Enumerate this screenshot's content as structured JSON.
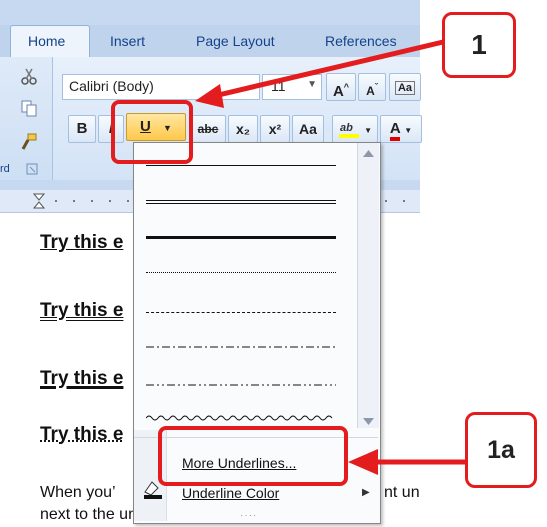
{
  "ribbon": {
    "tabs": [
      "Home",
      "Insert",
      "Page Layout",
      "References"
    ],
    "font_name": "Calibri (Body)",
    "font_size": "11",
    "group_label": "rd",
    "buttons": {
      "bold": "B",
      "italic": "I",
      "underline": "U",
      "strikethrough": "abc",
      "subscript": "x₂",
      "superscript": "x²",
      "change_case": "Aa",
      "grow_font": "A",
      "shrink_font": "A",
      "font_color": "A"
    }
  },
  "document": {
    "lines": [
      "Try this e",
      "Try this e",
      "Try this e",
      "Try this e"
    ],
    "paragraph_1": "When you’",
    "paragraph_1_tail": "nt un",
    "paragraph_2": "next to the underline button Or click on the l"
  },
  "menu": {
    "underline_styles": [
      "single",
      "double",
      "thick",
      "dotted",
      "dashed",
      "dash-dot",
      "dash-dot-dot",
      "wave"
    ],
    "more_underlines": "More Underlines...",
    "underline_color": "Underline Color"
  },
  "callouts": {
    "step_1": "1",
    "step_1a": "1a"
  },
  "colors": {
    "accent_red": "#e31d1d",
    "ribbon_blue": "#c6d9f0",
    "highlight_yellow": "#ffff00",
    "font_red": "#e00000"
  }
}
